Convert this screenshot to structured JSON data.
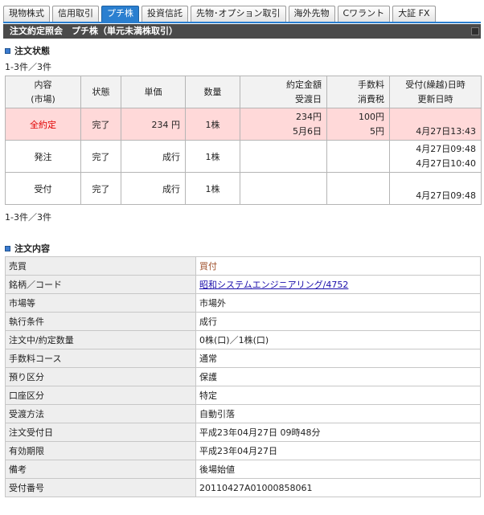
{
  "tabs": [
    {
      "label": "現物株式",
      "active": false
    },
    {
      "label": "信用取引",
      "active": false
    },
    {
      "label": "プチ株",
      "active": true
    },
    {
      "label": "投資信託",
      "active": false
    },
    {
      "label": "先物･オプション取引",
      "active": false
    },
    {
      "label": "海外先物",
      "active": false
    },
    {
      "label": "Cワラント",
      "active": false
    },
    {
      "label": "大証 FX",
      "active": false
    }
  ],
  "page_title": "注文約定照会　プチ株（単元未満株取引）",
  "order_status": {
    "section_title": "注文状態",
    "count_text": "1-3件／3件",
    "headers": {
      "content": [
        "内容",
        "(市場)"
      ],
      "status": "状態",
      "unit_price": "単価",
      "quantity": "数量",
      "amount": [
        "約定金額",
        "受渡日"
      ],
      "fee": [
        "手数料",
        "消費税"
      ],
      "datetime": [
        "受付(繰越)日時",
        "更新日時"
      ]
    },
    "rows": [
      {
        "content": "全約定",
        "status": "完了",
        "unit_price": "234 円",
        "quantity": "1株",
        "amount": "234円",
        "delivery_date": "5月6日",
        "fee": "100円",
        "tax": "5円",
        "received": "",
        "updated": "4月27日13:43"
      },
      {
        "content": "発注",
        "status": "完了",
        "unit_price": "成行",
        "quantity": "1株",
        "amount": "",
        "delivery_date": "",
        "fee": "",
        "tax": "",
        "received": "4月27日09:48",
        "updated": "4月27日10:40"
      },
      {
        "content": "受付",
        "status": "完了",
        "unit_price": "成行",
        "quantity": "1株",
        "amount": "",
        "delivery_date": "",
        "fee": "",
        "tax": "",
        "received": "",
        "updated": "4月27日09:48"
      }
    ],
    "count_text_bottom": "1-3件／3件"
  },
  "order_details": {
    "section_title": "注文内容",
    "rows": [
      {
        "label": "売買",
        "value": "買付"
      },
      {
        "label": "銘柄／コード",
        "value": "昭和システムエンジニアリング/4752"
      },
      {
        "label": "市場等",
        "value": "市場外"
      },
      {
        "label": "執行条件",
        "value": "成行"
      },
      {
        "label": "注文中/約定数量",
        "value": "0株(口)／1株(口)"
      },
      {
        "label": "手数料コース",
        "value": "通常"
      },
      {
        "label": "預り区分",
        "value": "保護"
      },
      {
        "label": "口座区分",
        "value": "特定"
      },
      {
        "label": "受渡方法",
        "value": "自動引落"
      },
      {
        "label": "注文受付日",
        "value": "平成23年04月27日 09時48分"
      },
      {
        "label": "有効期限",
        "value": "平成23年04月27日"
      },
      {
        "label": "備考",
        "value": "後場始値"
      },
      {
        "label": "受付番号",
        "value": "20110427A01000858061"
      }
    ]
  },
  "colors": {
    "tab_active": "#2a7fd0",
    "header_bar": "#4a4a4a",
    "highlight_row": "#ffd9d9",
    "status_red": "#e00000",
    "side_brown": "#a0522d"
  }
}
